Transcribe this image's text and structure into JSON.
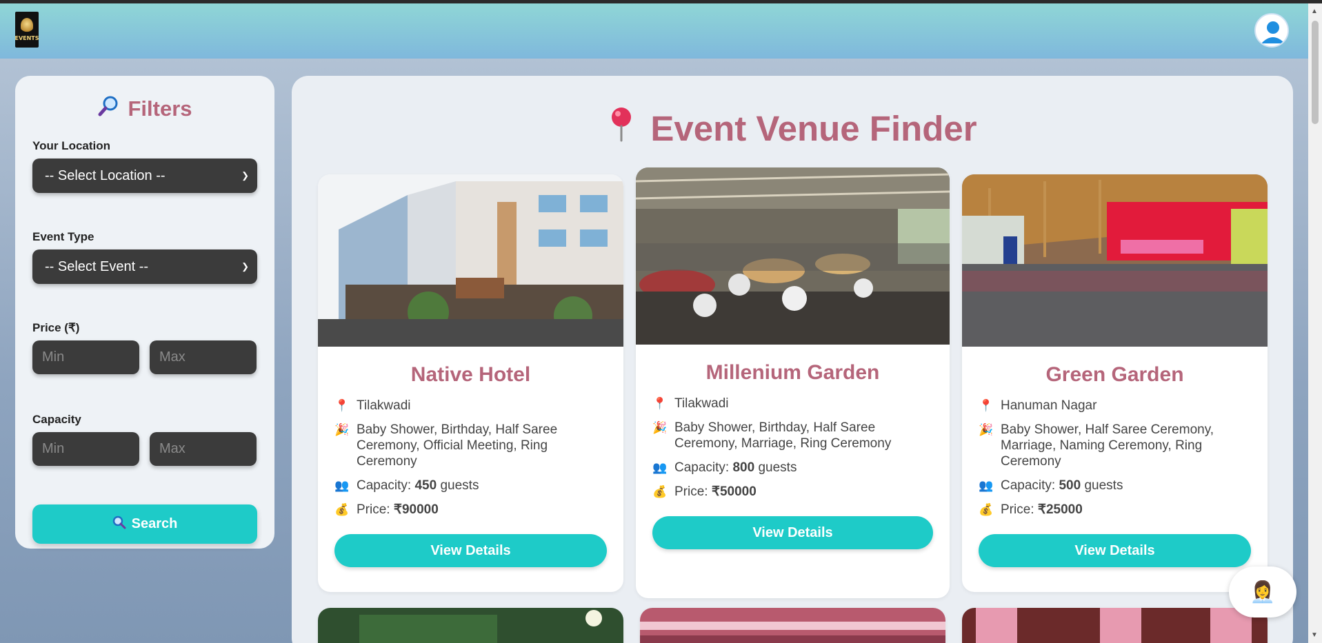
{
  "brand": {
    "logo_text": "EVENTS"
  },
  "filters": {
    "title": "Filters",
    "location": {
      "label": "Your Location",
      "selected": "-- Select Location --"
    },
    "event_type": {
      "label": "Event Type",
      "selected": "-- Select Event --"
    },
    "price": {
      "label": "Price (₹)",
      "min_placeholder": "Min",
      "max_placeholder": "Max"
    },
    "capacity": {
      "label": "Capacity",
      "min_placeholder": "Min",
      "max_placeholder": "Max"
    },
    "search_label": "Search"
  },
  "main": {
    "title": "Event Venue Finder",
    "venues": [
      {
        "name": "Native Hotel",
        "location": "Tilakwadi",
        "events": "Baby Shower, Birthday, Half Saree Ceremony, Official Meeting, Ring Ceremony",
        "capacity_prefix": "Capacity:",
        "capacity": "450",
        "capacity_suffix": "guests",
        "price_prefix": "Price:",
        "price": "₹90000",
        "button": "View Details"
      },
      {
        "name": "Millenium Garden",
        "location": "Tilakwadi",
        "events": "Baby Shower, Birthday, Half Saree Ceremony, Marriage, Ring Ceremony",
        "capacity_prefix": "Capacity:",
        "capacity": "800",
        "capacity_suffix": "guests",
        "price_prefix": "Price:",
        "price": "₹50000",
        "button": "View Details"
      },
      {
        "name": "Green Garden",
        "location": "Hanuman Nagar",
        "events": "Baby Shower, Half Saree Ceremony, Marriage, Naming Ceremony, Ring Ceremony",
        "capacity_prefix": "Capacity:",
        "capacity": "500",
        "capacity_suffix": "guests",
        "price_prefix": "Price:",
        "price": "₹25000",
        "button": "View Details"
      }
    ]
  },
  "icons": {
    "filters": "magnifier-icon",
    "title": "pushpin-icon",
    "location": "pin-icon",
    "events": "party-popper-icon",
    "capacity": "people-icon",
    "price": "money-bag-icon",
    "chat": "support-agent-icon"
  },
  "colors": {
    "accent": "#1ecbc8",
    "heading": "#b5657a",
    "input_bg": "#3b3b3b"
  }
}
